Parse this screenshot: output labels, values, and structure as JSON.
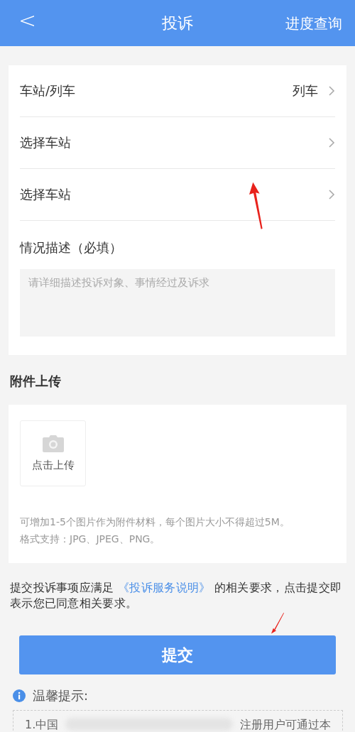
{
  "header": {
    "back_icon": "<",
    "title": "投诉",
    "action": "进度查询"
  },
  "info_section": {
    "rows": [
      {
        "label": "车站/列车",
        "value": "列车"
      },
      {
        "label": "选择车站"
      },
      {
        "label": "选择车站"
      }
    ],
    "description": {
      "label": "情况描述（必填）",
      "placeholder": "请详细描述投诉对象、事情经过及诉求"
    }
  },
  "attachment_section": {
    "title": "附件上传",
    "upload_label": "点击上传",
    "hints": [
      "可增加1-5个图片作为附件材料，每个图片大小不得超过5M。",
      "格式支持：JPG、JPEG、PNG。"
    ]
  },
  "agreement": {
    "before": "提交投诉事项应满足",
    "link": "《投诉服务说明》",
    "after": "的相关要求，点击提交即表示您已同意相关要求。"
  },
  "submit_button": "提交",
  "tips": {
    "title": "温馨提示:",
    "line_start": "1.中国",
    "line_end": "注册用户可通过本"
  }
}
